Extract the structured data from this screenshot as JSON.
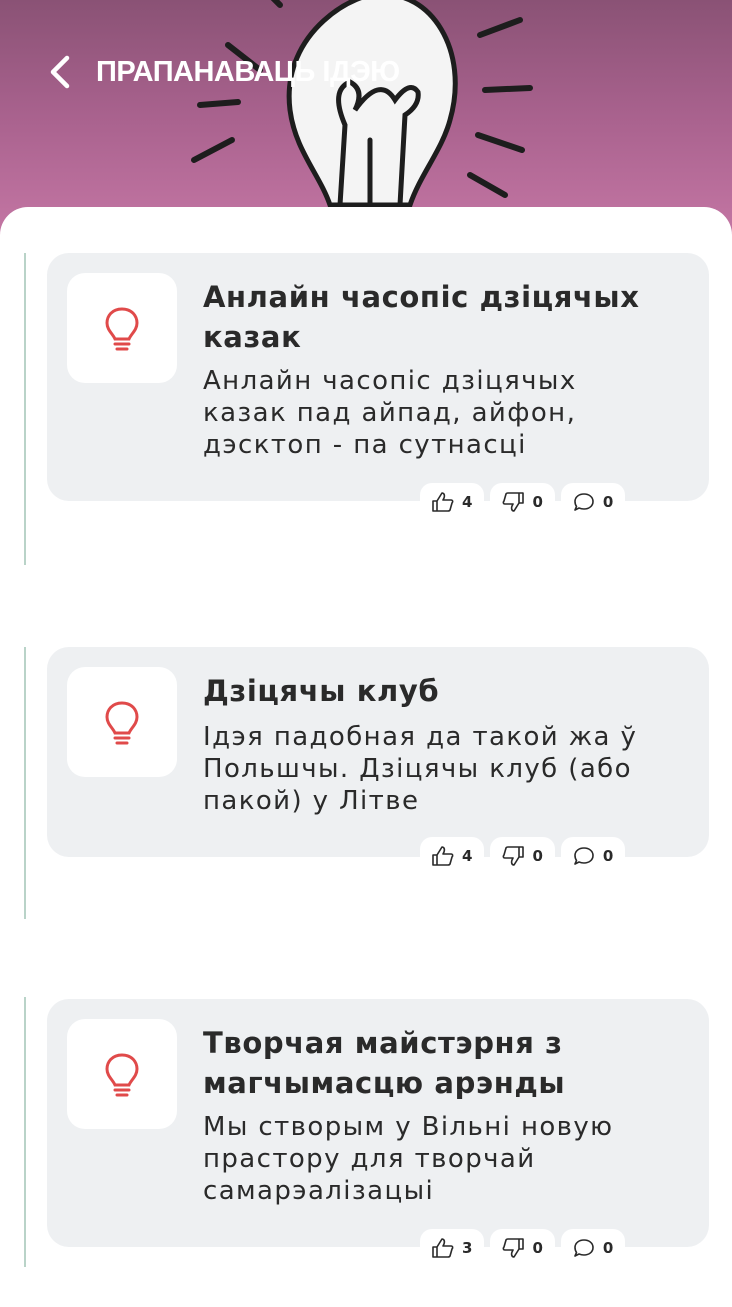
{
  "header": {
    "title": "ПРАПАНАВАЦЬ ІДЭЮ",
    "back_icon": "chevron-left-icon"
  },
  "accent_color": "#e04a4a",
  "ideas": [
    {
      "title": "Анлайн часопіс дзіцячых казак",
      "description": "Анлайн часопіс дзіцячых казак пад айпад, айфон, дэсктоп - па сутнасці",
      "likes": "4",
      "dislikes": "0",
      "comments": "0"
    },
    {
      "title": "Дзіцячы клуб",
      "description": "Ідэя падобная да такой жа ў Польшчы. Дзіцячы клуб (або пакой) у Літве",
      "likes": "4",
      "dislikes": "0",
      "comments": "0"
    },
    {
      "title": "Творчая майстэрня з магчымасцю арэнды",
      "description": "Мы створым у Вільні новую прастору для творчай самарэалізацыі",
      "likes": "3",
      "dislikes": "0",
      "comments": "0"
    }
  ]
}
